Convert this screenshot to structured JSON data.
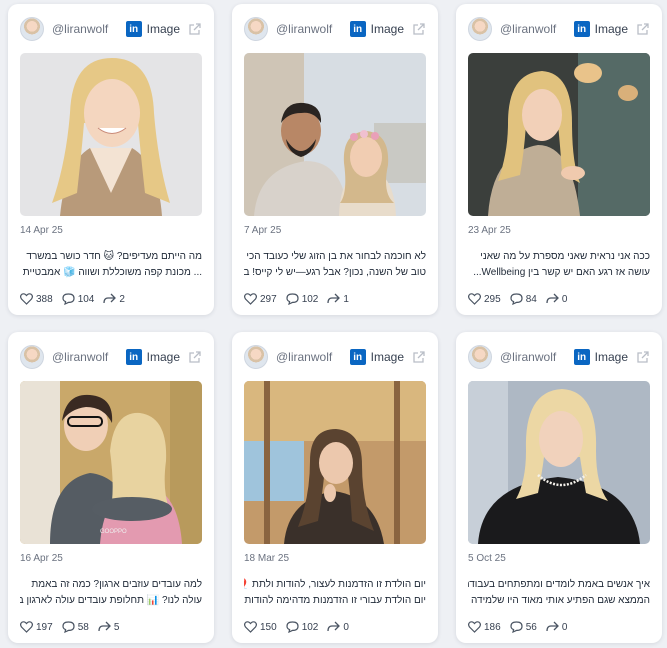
{
  "posts": [
    {
      "handle": "@liranwolf",
      "type": "Image",
      "date": "14 Apr 25",
      "line1": "מה הייתם מעדיפים? 🐱 חדר כושר במשרד",
      "line2": "... מכונת קפה משוכללת ושווה 🧊 אמבטיית",
      "likes": "388",
      "comments": "104",
      "shares": "2"
    },
    {
      "handle": "@liranwolf",
      "type": "Image",
      "date": "7 Apr 25",
      "line1": "לא חוכמה לבחור את בן הזוג שלי כעובד הכי",
      "line2": "טוב של השנה, נכון? אבל רגע—יש לי קייס! בן",
      "likes": "297",
      "comments": "102",
      "shares": "1"
    },
    {
      "handle": "@liranwolf",
      "type": "Image",
      "date": "23 Apr 25",
      "line1": "ככה אני נראית שאני מספרת על מה שאני",
      "line2": "עושה אז רגע האם יש קשר בין Wellbeing...",
      "likes": "295",
      "comments": "84",
      "shares": "0"
    },
    {
      "handle": "@liranwolf",
      "type": "Image",
      "date": "16 Apr 25",
      "line1": "למה עובדים עוזבים ארגון? כמה זה באמת",
      "line2": "עולה לנו? 📊 תחלופת עובדים עולה לארגון בין",
      "likes": "197",
      "comments": "58",
      "shares": "5"
    },
    {
      "handle": "@liranwolf",
      "type": "Image",
      "date": "18 Mar 25",
      "line1": "יום הולדת זו הזדמנות לעצור, להודות ולתת 🎈",
      "line2": "יום הולדת עבורי זו הזדמנות מדהימה להודות",
      "likes": "150",
      "comments": "102",
      "shares": "0"
    },
    {
      "handle": "@liranwolf",
      "type": "Image",
      "date": "5 Oct 25",
      "line1": "איך אנשים באמת לומדים ומתפתחים בעבודה?",
      "line2": "הממצא שגם הפתיע אותי מאוד היו שלמידה",
      "likes": "186",
      "comments": "56",
      "shares": "0"
    }
  ],
  "icons": {
    "linkedin": "linkedin-icon",
    "external": "external-link-icon",
    "like": "heart-icon",
    "comment": "comment-icon",
    "share": "share-icon"
  },
  "colors": {
    "linkedin": "#0a66c2",
    "background": "#eef0f4"
  }
}
